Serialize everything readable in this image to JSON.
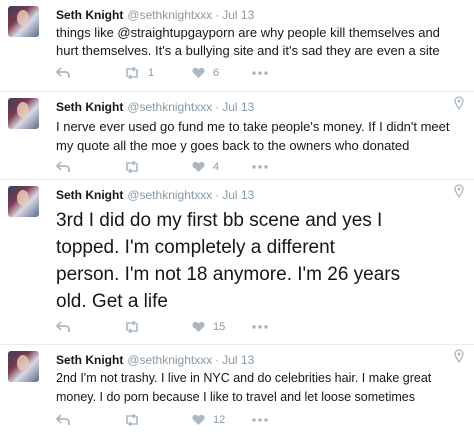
{
  "tweets": [
    {
      "name": "Seth Knight",
      "handle": "@sethknightxxx",
      "separator": "·",
      "time": "Jul 13",
      "text_lines": [
        "things like @straightupgayporn are why people kill themselves and",
        "hurt themselves.  It's a bullying site and it's sad they are even a site"
      ],
      "retweets": "1",
      "likes": "6"
    },
    {
      "name": "Seth Knight",
      "handle": "@sethknightxxx",
      "separator": "·",
      "time": "Jul 13",
      "text_lines": [
        "I nerve ever used go fund me to take people's money.   If I didn't meet",
        "my quote all the moe y goes back to the owners who donated"
      ],
      "retweets": "",
      "likes": "4"
    },
    {
      "name": "Seth Knight",
      "handle": "@sethknightxxx",
      "separator": "·",
      "time": "Jul 13",
      "text_lines": [
        "3rd I did do my first bb scene and yes I",
        "topped.  I'm completely a different",
        "person.  I'm not 18 anymore.  I'm 26 years",
        "old. Get a life"
      ],
      "retweets": "",
      "likes": "15"
    },
    {
      "name": "Seth Knight",
      "handle": "@sethknightxxx",
      "separator": "·",
      "time": "Jul 13",
      "text_lines": [
        "2nd I'm not trashy.  I live in NYC and do celebrities hair. I make great",
        "money.  I do porn because I like to travel and let loose sometimes"
      ],
      "retweets": "",
      "likes": "12"
    }
  ],
  "icons": {
    "reply": "reply-icon",
    "retweet": "retweet-icon",
    "like": "heart-icon",
    "more": "more-icon",
    "location": "location-pin-icon"
  },
  "colors": {
    "icon": "#aab8c2",
    "meta": "#8899a6",
    "text": "#14171a",
    "divider": "#e6ecf0"
  }
}
